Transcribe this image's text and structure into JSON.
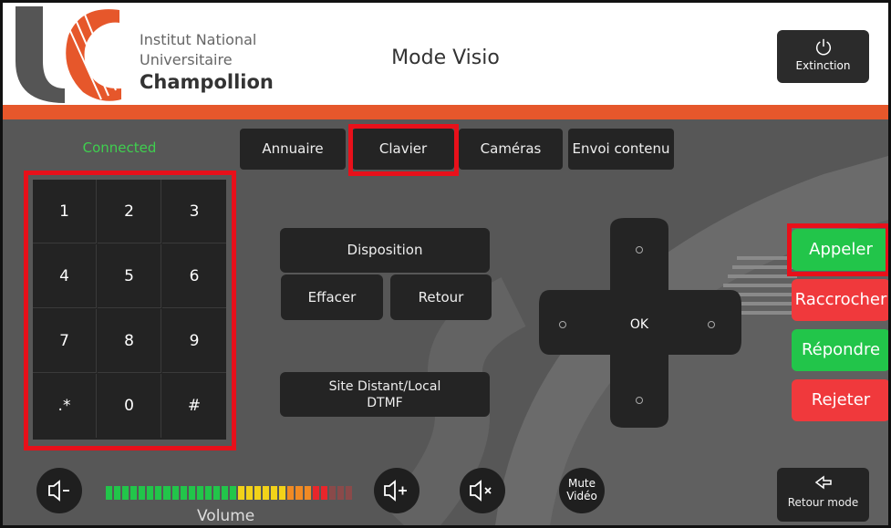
{
  "header": {
    "institution_line1": "Institut National",
    "institution_line2": "Universitaire",
    "institution_line3": "Champollion",
    "mode_title": "Mode Visio",
    "extinction_label": "Extinction"
  },
  "status": "Connected",
  "tabs": [
    {
      "label": "Annuaire"
    },
    {
      "label": "Clavier",
      "selected": true
    },
    {
      "label": "Caméras"
    },
    {
      "label": "Envoi contenu"
    }
  ],
  "keypad": [
    "1",
    "2",
    "3",
    "4",
    "5",
    "6",
    "7",
    "8",
    "9",
    ".*",
    "0",
    "#"
  ],
  "controls": {
    "disposition": "Disposition",
    "effacer": "Effacer",
    "retour": "Retour",
    "site_line1": "Site Distant/Local",
    "site_line2": "DTMF"
  },
  "dpad": {
    "ok_label": "OK"
  },
  "call_buttons": {
    "appeler": "Appeler",
    "raccrocher": "Raccrocher",
    "repondre": "Répondre",
    "rejeter": "Rejeter"
  },
  "bottom": {
    "volume_label": "Volume",
    "mute_video_line1": "Mute",
    "mute_video_line2": "Vidéo",
    "retour_mode": "Retour mode",
    "volume_level": 0.9
  },
  "colors": {
    "accent_orange": "#e6572b",
    "highlight_red": "#e8101a",
    "green": "#22c54a",
    "red": "#f0393c",
    "connected_green": "#3fcf4f"
  }
}
